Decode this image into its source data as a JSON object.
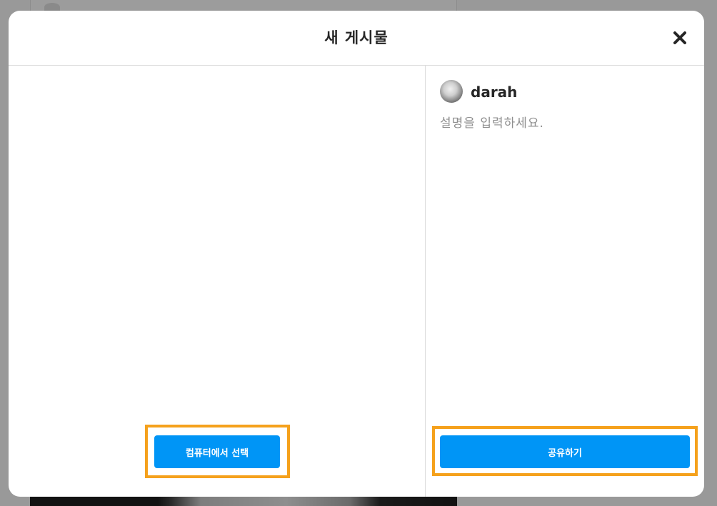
{
  "modal": {
    "title": "새 게시물",
    "close_icon": "close-icon"
  },
  "composer": {
    "username": "darah",
    "caption_placeholder": "설명을 입력하세요.",
    "caption_value": ""
  },
  "actions": {
    "select_from_computer": "컴퓨터에서 선택",
    "share": "공유하기"
  },
  "colors": {
    "primary_button": "#0095f6",
    "highlight_border": "#f5a11c",
    "divider": "#dbdbdb",
    "overlay": "#999999"
  }
}
